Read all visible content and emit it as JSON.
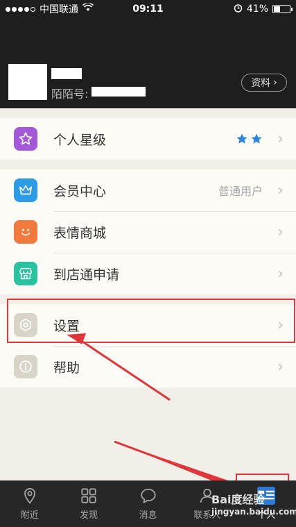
{
  "status_bar": {
    "carrier": "中国联通",
    "time": "09:11",
    "battery": "41%",
    "battery_level": 0.41
  },
  "profile": {
    "momo_label": "陌陌号:",
    "info_button": "资料"
  },
  "menu": {
    "star_level": {
      "label": "个人星级",
      "stars": 2
    },
    "vip_center": {
      "label": "会员中心",
      "value": "普通用户"
    },
    "emoji_shop": {
      "label": "表情商城"
    },
    "store_apply": {
      "label": "到店通申请"
    },
    "settings": {
      "label": "设置"
    },
    "help": {
      "label": "帮助"
    }
  },
  "tabbar": {
    "tabs": [
      {
        "label": "附近"
      },
      {
        "label": "发现"
      },
      {
        "label": "消息"
      },
      {
        "label": "联系人"
      },
      {
        "label": "个人"
      }
    ]
  },
  "watermark": {
    "text": "Bai度经验",
    "url": "jingyan.baidu.com"
  },
  "colors": {
    "star_icon": "#a45ad8",
    "vip_icon": "#2e9be6",
    "emoji_icon": "#f27a3c",
    "store_icon": "#2ac3a0",
    "settings_icon": "#d8d5c8",
    "help_icon": "#d8d5c8",
    "annotation": "#e0353b"
  }
}
